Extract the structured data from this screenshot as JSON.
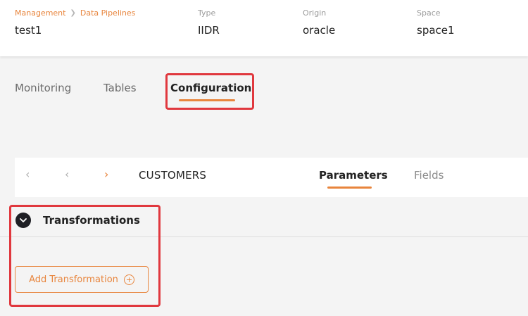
{
  "header": {
    "breadcrumb": [
      "Management",
      "Data Pipelines"
    ],
    "title": "test1",
    "fields": [
      {
        "label": "Type",
        "value": "IIDR"
      },
      {
        "label": "Origin",
        "value": "oracle"
      },
      {
        "label": "Space",
        "value": "space1"
      }
    ]
  },
  "tabs": [
    {
      "label": "Monitoring"
    },
    {
      "label": "Tables"
    },
    {
      "label": "Configuration",
      "active": true
    }
  ],
  "table_nav": {
    "entity": "CUSTOMERS",
    "subtabs": [
      {
        "label": "Parameters",
        "active": true
      },
      {
        "label": "Fields"
      }
    ]
  },
  "section": {
    "title": "Transformations",
    "add_button_label": "Add Transformation"
  },
  "colors": {
    "accent": "#e8853d",
    "annotation": "#e0383e",
    "section_icon_bg": "#1e1f24"
  },
  "icons": [
    "chevron-left-icon",
    "chevron-right-icon",
    "chevron-down-icon",
    "plus-circle-icon"
  ]
}
